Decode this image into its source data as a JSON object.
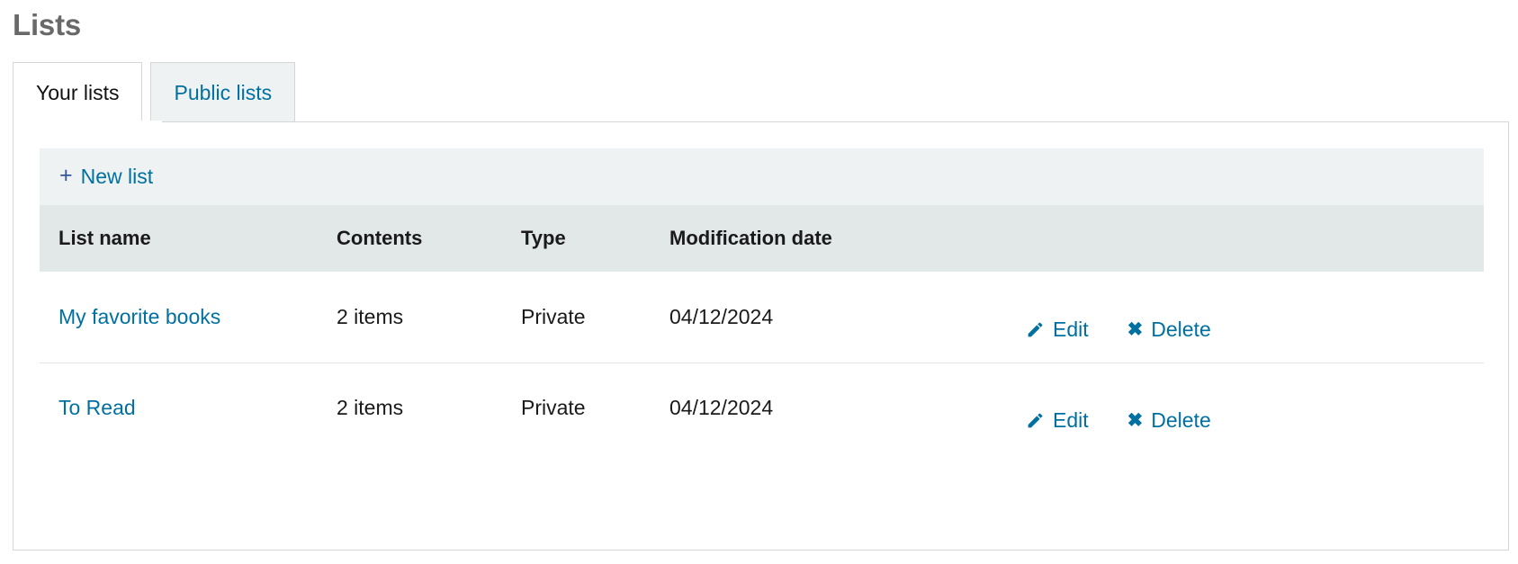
{
  "page": {
    "title": "Lists"
  },
  "tabs": [
    {
      "label": "Your lists",
      "active": true
    },
    {
      "label": "Public lists",
      "active": false
    }
  ],
  "toolbar": {
    "new_list_label": "New list",
    "plus_icon": "plus-icon"
  },
  "table": {
    "columns": [
      "List name",
      "Contents",
      "Type",
      "Modification date",
      ""
    ],
    "rows": [
      {
        "name": "My favorite books",
        "contents": "2 items",
        "type": "Private",
        "modification_date": "04/12/2024",
        "edit_label": "Edit",
        "delete_label": "Delete"
      },
      {
        "name": "To Read",
        "contents": "2 items",
        "type": "Private",
        "modification_date": "04/12/2024",
        "edit_label": "Edit",
        "delete_label": "Delete"
      }
    ]
  },
  "colors": {
    "link": "#0070a0",
    "title": "#696969",
    "toolbar_bg": "#eef2f2",
    "header_bg": "#e2e7e7",
    "plus": "#32559a",
    "border": "#d6d6d6"
  }
}
